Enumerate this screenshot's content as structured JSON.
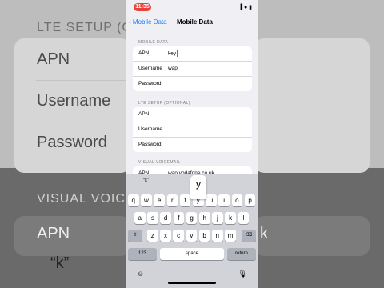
{
  "background": {
    "lte_header": "LTE SETUP (OP",
    "apn": "APN",
    "username": "Username",
    "password": "Password",
    "visual_header": "VISUAL VOICEM",
    "apn2": "APN",
    "key_bubble": "“k”",
    "right_edge": "k"
  },
  "status_bar": {
    "time": "11:35",
    "icons": "▐ ● ▮"
  },
  "nav": {
    "back_label": "Mobile Data",
    "title": "Mobile Data"
  },
  "mobile_data": {
    "header": "MOBILE DATA",
    "rows": [
      {
        "label": "APN",
        "value": "key"
      },
      {
        "label": "Username",
        "value": "wap"
      },
      {
        "label": "Password",
        "value": ""
      }
    ]
  },
  "lte_setup": {
    "header": "LTE SETUP (OPTIONAL)",
    "rows": [
      {
        "label": "APN",
        "value": ""
      },
      {
        "label": "Username",
        "value": ""
      },
      {
        "label": "Password",
        "value": ""
      }
    ]
  },
  "visual_voicemail": {
    "header": "VISUAL VOICEMAIL",
    "rows": [
      {
        "label": "APN",
        "value": "wap.vodafone.co.uk"
      }
    ]
  },
  "keyboard": {
    "suggestion": "“k”",
    "popup_key": "y",
    "row1": [
      "q",
      "w",
      "e",
      "r",
      "t",
      "y",
      "u",
      "i",
      "o",
      "p"
    ],
    "row2": [
      "a",
      "s",
      "d",
      "f",
      "g",
      "h",
      "j",
      "k",
      "l"
    ],
    "row3": [
      "z",
      "x",
      "c",
      "v",
      "b",
      "n",
      "m"
    ],
    "shift": "⇧",
    "delete": "⌫",
    "numbers": "123",
    "space": "space",
    "return": "return",
    "emoji": "☺",
    "mic": "🎙"
  }
}
